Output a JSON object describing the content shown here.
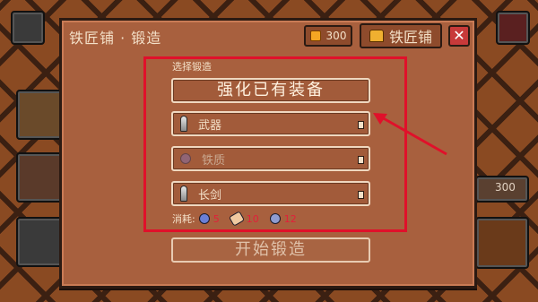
{
  "dialog": {
    "title": "铁匠铺 · 锻造",
    "coins": "300",
    "shop_label": "铁匠铺",
    "close_label": "✕"
  },
  "forge": {
    "section_label": "选择锻造",
    "enhance_button": "强化已有装备",
    "rows": [
      {
        "label": "武器",
        "icon": "sword-icon"
      },
      {
        "label": "铁质",
        "icon": "gem-icon"
      },
      {
        "label": "长剑",
        "icon": "sword-icon"
      }
    ],
    "cost_label": "消耗:",
    "costs": [
      {
        "icon": "blue-ore-icon",
        "amount": "5"
      },
      {
        "icon": "bandage-icon",
        "amount": "10"
      },
      {
        "icon": "gray-ore-icon",
        "amount": "12"
      }
    ],
    "start_button": "开始锻造"
  },
  "background": {
    "side_coins": "300"
  },
  "colors": {
    "highlight": "#e0102a",
    "dialog_bg": "#a8603e",
    "cost_number": "#e2203a"
  }
}
